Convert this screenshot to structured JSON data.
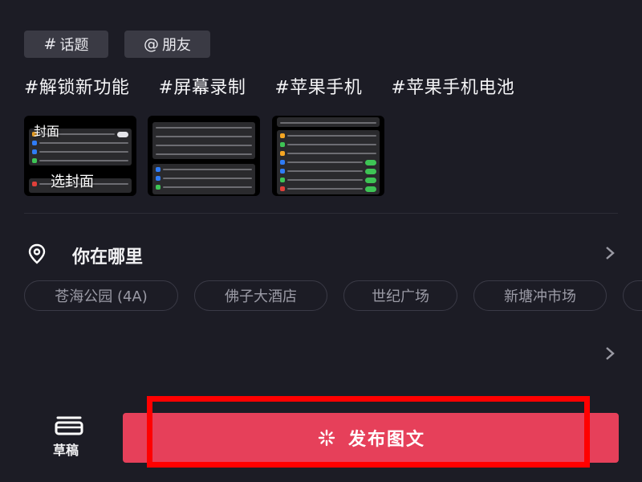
{
  "chips": {
    "topic": {
      "symbol": "#",
      "label": "话题"
    },
    "friend": {
      "symbol": "@",
      "label": "朋友"
    }
  },
  "hashtags": [
    "#解锁新功能",
    "#屏幕录制",
    "#苹果手机",
    "#苹果手机电池"
  ],
  "images": {
    "cover_label": "封面",
    "select_cover_label": "选封面",
    "count": 3
  },
  "location": {
    "title": "你在哪里",
    "suggestions": [
      "苍海公园 (4A)",
      "佛子大酒店",
      "世纪广场",
      "新塘冲市场"
    ]
  },
  "bottom": {
    "draft_label": "草稿",
    "publish_label": "发布图文"
  },
  "colors": {
    "background": "#1c1c25",
    "publish": "#e6405a",
    "highlight": "#ff0000"
  }
}
